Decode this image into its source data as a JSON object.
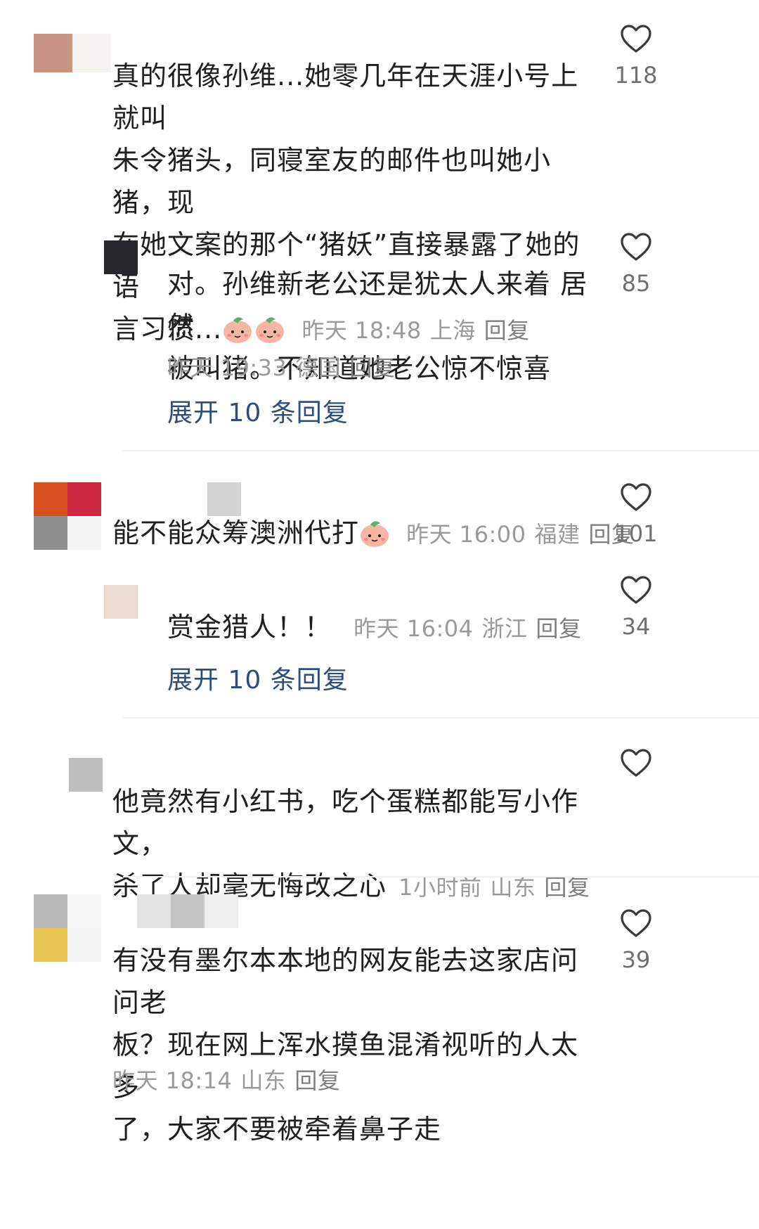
{
  "comments": [
    {
      "text": "真的很像孙维...她零几年在天涯小号上就叫朱令猪头，同寝室友的邮件也叫她小猪，现在她文案的那个“猪妖”直接暴露了她的语言习惯...",
      "lines": [
        "真的很像孙维...她零几年在天涯小号上就叫",
        "朱令猪头，同寝室友的邮件也叫她小猪，现",
        "在她文案的那个“猪妖”直接暴露了她的语",
        "言习惯..."
      ],
      "time": "昨天 18:48",
      "location": "上海",
      "reply_label": "回复",
      "likes": "118"
    },
    {
      "text": "对。孙维新老公还是犹太人来着 居然被叫猪。不知道她老公惊不惊喜",
      "lines": [
        "对。孙维新老公还是犹太人来着 居然",
        "被叫猪。不知道她老公惊不惊喜"
      ],
      "time": "昨天 19:33",
      "location": "德国",
      "reply_label": "回复",
      "likes": "85"
    },
    {
      "text": "能不能众筹澳洲代打",
      "time": "昨天 16:00",
      "location": "福建",
      "reply_label": "回复",
      "likes": "101"
    },
    {
      "text": "赏金猎人！！",
      "time": "昨天 16:04",
      "location": "浙江",
      "reply_label": "回复",
      "likes": "34"
    },
    {
      "text": "他竟然有小红书，吃个蛋糕都能写小作文，杀了人却毫无悔改之心",
      "lines": [
        "他竟然有小红书，吃个蛋糕都能写小作文，",
        "杀了人却毫无悔改之心"
      ],
      "time": "1小时前",
      "location": "山东",
      "reply_label": "回复",
      "likes": ""
    },
    {
      "text": "有没有墨尔本本地的网友能去这家店问问老板？现在网上浑水摸鱼混淆视听的人太多了，大家不要被牵着鼻子走",
      "lines": [
        "有没有墨尔本本地的网友能去这家店问问老",
        "板？现在网上浑水摸鱼混淆视听的人太多",
        "了，大家不要被牵着鼻子走"
      ],
      "time": "昨天 18:14",
      "location": "山东",
      "reply_label": "回复",
      "likes": "39"
    }
  ],
  "expand_1": "展开 10 条回复",
  "expand_2": "展开 10 条回复",
  "icons": {
    "like": "heart-outline-icon",
    "emoji": "peach-face-emoji-icon"
  },
  "colors": {
    "link": "#2e4d7a",
    "meta": "#9a9a9a",
    "icon": "#3a3a3a"
  }
}
